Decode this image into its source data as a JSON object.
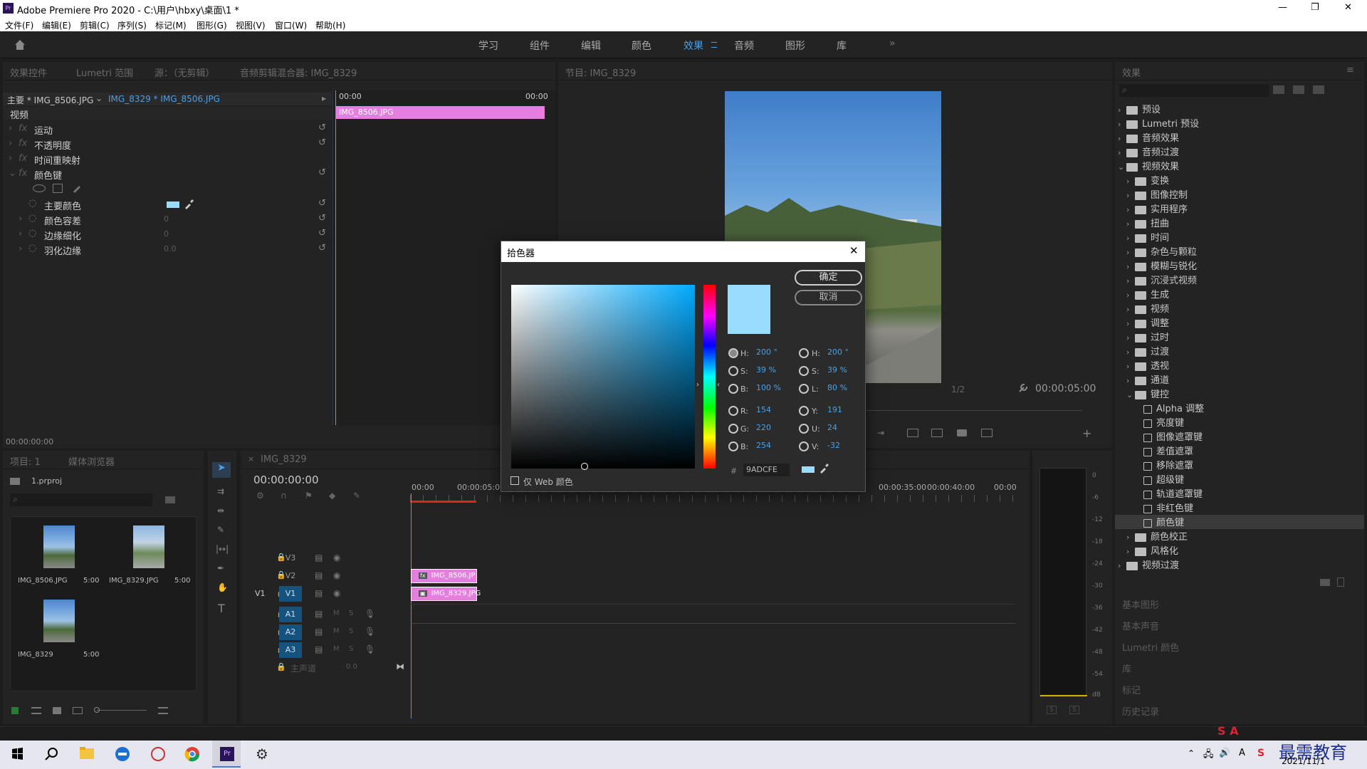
{
  "window": {
    "title": "Adobe Premiere Pro 2020 - C:\\用户\\hbxy\\桌面\\1 *",
    "controls": [
      "—",
      "❐",
      "✕"
    ]
  },
  "menu": [
    "文件(F)",
    "编辑(E)",
    "剪辑(C)",
    "序列(S)",
    "标记(M)",
    "图形(G)",
    "视图(V)",
    "窗口(W)",
    "帮助(H)"
  ],
  "workspaces": {
    "items": [
      "学习",
      "组件",
      "编辑",
      "颜色",
      "效果",
      "音频",
      "图形",
      "库"
    ],
    "active": "效果",
    "more": "»"
  },
  "effect_controls": {
    "tabs": [
      "效果控件",
      "Lumetri 范围",
      "源：（无剪辑）",
      "音频剪辑混合器: IMG_8329"
    ],
    "master": "主要 * IMG_8506.JPG",
    "sequence": "IMG_8329 * IMG_8506.JPG",
    "time_left": "00:00",
    "time_right": "00:00",
    "clip": "IMG_8506.JPG",
    "section": "视频",
    "fx": [
      "运动",
      "不透明度",
      "时间重映射",
      "颜色键"
    ],
    "props": [
      {
        "label": "主要颜色",
        "value": ""
      },
      {
        "label": "颜色容差",
        "value": "0"
      },
      {
        "label": "边缘细化",
        "value": "0"
      },
      {
        "label": "羽化边缘",
        "value": "0.0"
      }
    ],
    "timecode": "00:00:00:00"
  },
  "program": {
    "title": "节目: IMG_8329",
    "fit": "1/2",
    "timecode": "00:00:05:00"
  },
  "project": {
    "tabs": [
      "项目: 1",
      "媒体浏览器"
    ],
    "file": "1.prproj",
    "items": [
      {
        "name": "IMG_8506.JPG",
        "duration": "5:00"
      },
      {
        "name": "IMG_8329.JPG",
        "duration": "5:00"
      },
      {
        "name": "IMG_8329",
        "duration": "5:00"
      }
    ]
  },
  "timeline": {
    "tab": "IMG_8329",
    "timecode": "00:00:00:00",
    "ruler": [
      "00:00",
      "00:00:05:00",
      "00:00:35:00",
      "00:00:40:00",
      "00:00"
    ],
    "tracks": [
      "V3",
      "V2",
      "V1",
      "A1",
      "A2",
      "A3"
    ],
    "source_v1": "V1",
    "master": "主声道",
    "master_val": "0.0",
    "clips": [
      {
        "name": "IMG_8506.JP",
        "track": "V2"
      },
      {
        "name": "IMG_8329.JPG",
        "track": "V1"
      }
    ]
  },
  "effects": {
    "title": "效果",
    "tree": [
      {
        "label": "预设",
        "depth": 0,
        "open": false
      },
      {
        "label": "Lumetri 预设",
        "depth": 0,
        "open": false
      },
      {
        "label": "音频效果",
        "depth": 0,
        "open": false
      },
      {
        "label": "音频过渡",
        "depth": 0,
        "open": false
      },
      {
        "label": "视频效果",
        "depth": 0,
        "open": true
      },
      {
        "label": "变换",
        "depth": 1
      },
      {
        "label": "图像控制",
        "depth": 1
      },
      {
        "label": "实用程序",
        "depth": 1
      },
      {
        "label": "扭曲",
        "depth": 1
      },
      {
        "label": "时间",
        "depth": 1
      },
      {
        "label": "杂色与颗粒",
        "depth": 1
      },
      {
        "label": "模糊与锐化",
        "depth": 1
      },
      {
        "label": "沉浸式视频",
        "depth": 1
      },
      {
        "label": "生成",
        "depth": 1
      },
      {
        "label": "视频",
        "depth": 1
      },
      {
        "label": "调整",
        "depth": 1
      },
      {
        "label": "过时",
        "depth": 1
      },
      {
        "label": "过渡",
        "depth": 1
      },
      {
        "label": "透视",
        "depth": 1
      },
      {
        "label": "通道",
        "depth": 1
      },
      {
        "label": "键控",
        "depth": 1,
        "open": true
      },
      {
        "label": "Alpha 调整",
        "depth": 2
      },
      {
        "label": "亮度键",
        "depth": 2
      },
      {
        "label": "图像遮罩键",
        "depth": 2
      },
      {
        "label": "差值遮罩",
        "depth": 2
      },
      {
        "label": "移除遮罩",
        "depth": 2
      },
      {
        "label": "超级键",
        "depth": 2
      },
      {
        "label": "轨道遮罩键",
        "depth": 2
      },
      {
        "label": "非红色键",
        "depth": 2
      },
      {
        "label": "颜色键",
        "depth": 2,
        "selected": true
      },
      {
        "label": "颜色校正",
        "depth": 1
      },
      {
        "label": "风格化",
        "depth": 1
      },
      {
        "label": "视频过渡",
        "depth": 0
      }
    ],
    "sections": [
      "基本图形",
      "基本声音",
      "Lumetri 颜色",
      "库",
      "标记",
      "历史记录"
    ]
  },
  "meter": {
    "scale": [
      "0",
      "-6",
      "-12",
      "-18",
      "-24",
      "-30",
      "-36",
      "-42",
      "-48",
      "-54",
      "dB"
    ],
    "solo": [
      "S",
      "S"
    ]
  },
  "dialog": {
    "title": "拾色器",
    "ok": "确定",
    "cancel": "取消",
    "web_only": "仅 Web 颜色",
    "color": "#9ADCFE",
    "hex": "9ADCFE",
    "left": [
      {
        "k": "H:",
        "v": "200 °"
      },
      {
        "k": "S:",
        "v": "39 %"
      },
      {
        "k": "B:",
        "v": "100 %"
      },
      {
        "k": "R:",
        "v": "154"
      },
      {
        "k": "G:",
        "v": "220"
      },
      {
        "k": "B:",
        "v": "254"
      }
    ],
    "right": [
      {
        "k": "H:",
        "v": "200 °"
      },
      {
        "k": "S:",
        "v": "39 %"
      },
      {
        "k": "L:",
        "v": "80 %"
      },
      {
        "k": "Y:",
        "v": "191"
      },
      {
        "k": "U:",
        "v": "24"
      },
      {
        "k": "V:",
        "v": "-32"
      }
    ],
    "hash": "#"
  },
  "taskbar": {
    "date": "2021/11/1",
    "watermark": "最需教育",
    "ime": "S A"
  }
}
